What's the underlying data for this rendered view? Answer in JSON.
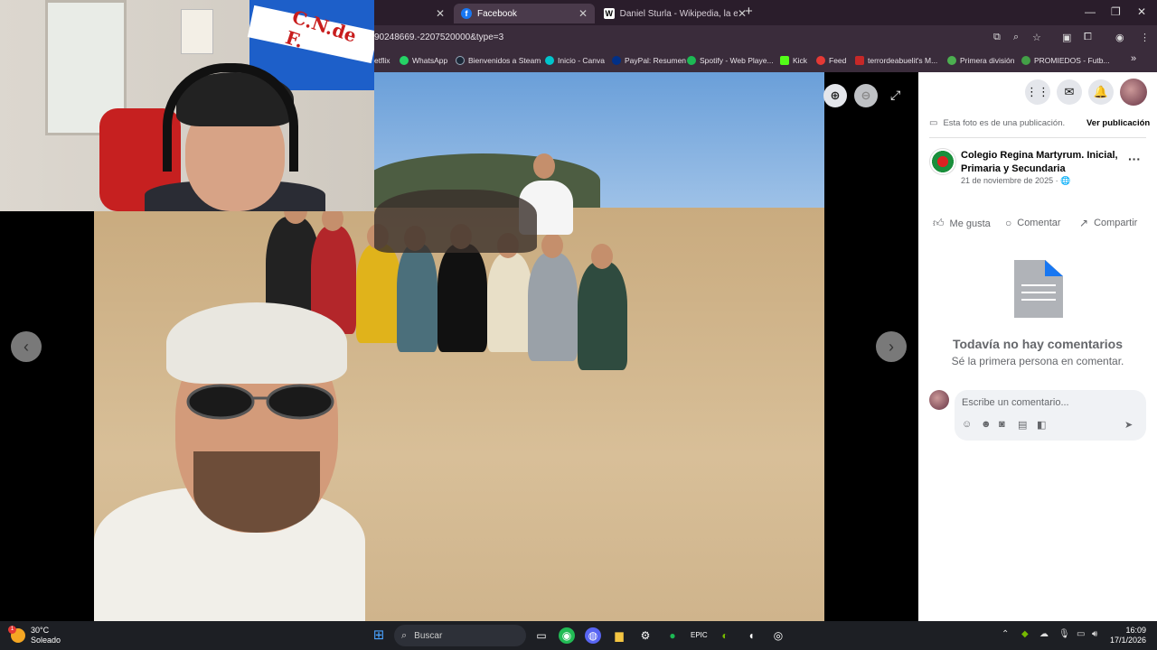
{
  "browser": {
    "tabs": [
      {
        "label": "",
        "active": false
      },
      {
        "label": "Facebook",
        "active": true
      },
      {
        "label": "Daniel Sturla - Wikipedia, la enc",
        "active": false
      }
    ],
    "new_tab": "+",
    "url": "90248669.-2207520000&type=3",
    "bookmarks": [
      {
        "label": "etflix",
        "color": "#e50914"
      },
      {
        "label": "WhatsApp",
        "color": "#25d366"
      },
      {
        "label": "Bienvenidos a Steam",
        "color": "#1b2838"
      },
      {
        "label": "Inicio - Canva",
        "color": "#00c4cc"
      },
      {
        "label": "PayPal: Resumen",
        "color": "#003087"
      },
      {
        "label": "Spotify - Web Playe...",
        "color": "#1db954"
      },
      {
        "label": "Kick",
        "color": "#53fc18"
      },
      {
        "label": "Feed",
        "color": "#e53935"
      },
      {
        "label": "terrordeabuelit's M...",
        "color": "#c62828"
      },
      {
        "label": "Primera división",
        "color": "#4caf50"
      },
      {
        "label": "PROMIEDOS - Futb...",
        "color": "#43a047"
      }
    ],
    "more_bookmarks": "»"
  },
  "webcam": {
    "flag_text": "C.N.de F."
  },
  "fb": {
    "publication_note": "Esta foto es de una publicación.",
    "view_publication": "Ver publicación",
    "page_name": "Colegio Regina Martyrum. Inicial, Primaria y Secundaria",
    "post_date": "21 de noviembre de 2025 · ",
    "actions": {
      "like": "Me gusta",
      "comment": "Comentar",
      "share": "Compartir"
    },
    "no_comments_title": "Todavía no hay comentarios",
    "no_comments_sub": "Sé la primera persona en comentar.",
    "comment_placeholder": "Escribe un comentario..."
  },
  "taskbar": {
    "temperature": "30°C",
    "condition": "Soleado",
    "weather_badge": "1",
    "search_label": "Buscar",
    "time": "16:09",
    "date": "17/1/2026"
  }
}
